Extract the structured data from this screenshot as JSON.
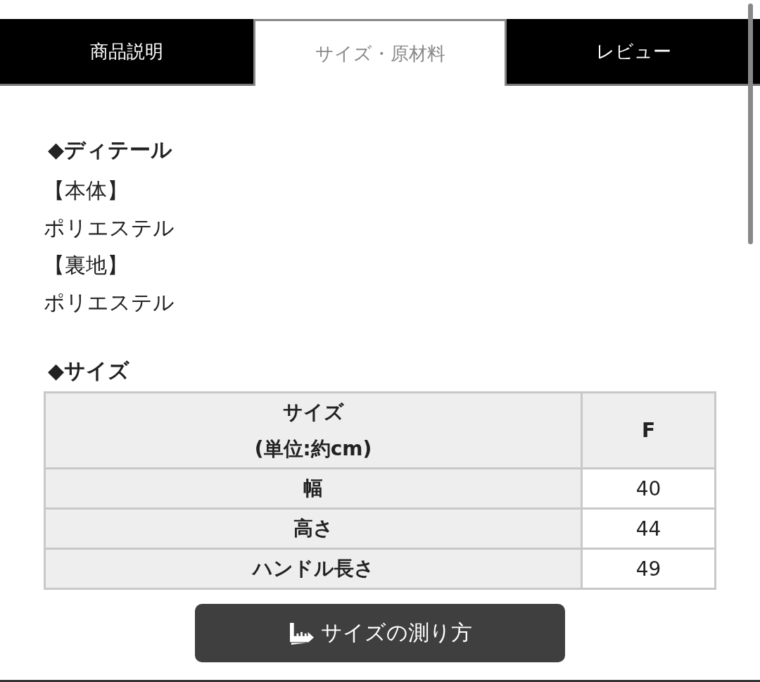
{
  "tabs": [
    {
      "label": "商品説明",
      "selected": false
    },
    {
      "label": "サイズ・原材料",
      "selected": true
    },
    {
      "label": "レビュー",
      "selected": false
    }
  ],
  "details": {
    "heading": "◆ディテール",
    "lines": [
      "【本体】",
      "ポリエステル",
      "【裏地】",
      "ポリエステル"
    ]
  },
  "size": {
    "heading": "◆サイズ",
    "table": {
      "columns": [
        "サイズ\n(単位:約cm)",
        "F"
      ],
      "rows": [
        [
          "幅",
          "40"
        ],
        [
          "高さ",
          "44"
        ],
        [
          "ハンドル長さ",
          "49"
        ]
      ]
    }
  },
  "measure_button": {
    "label": "サイズの測り方"
  }
}
